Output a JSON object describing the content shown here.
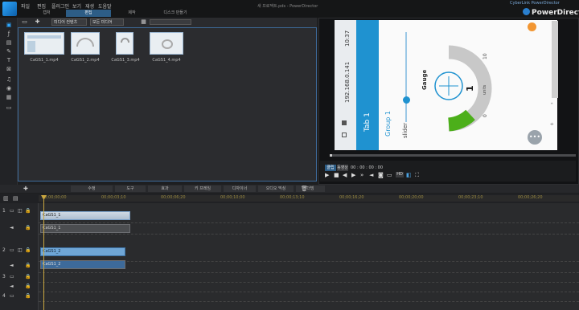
{
  "titlebar": {
    "menus": [
      "파일",
      "편집",
      "플러그인",
      "보기",
      "재생",
      "도움말"
    ],
    "doc_title": "새 프로젝트.pds - PowerDirector",
    "window_title": "CyberLink PowerDirector",
    "brand": "PowerDirector"
  },
  "mode_tabs": [
    "캡처",
    "편집",
    "제작",
    "디스크 만들기"
  ],
  "library": {
    "filter_dropdown": "미디어 컨텐츠",
    "sort_dropdown": "모든 미디어",
    "items": [
      {
        "label": "CaGS1_1.mp4"
      },
      {
        "label": "CaGS1_2.mp4"
      },
      {
        "label": "CaGS1_3.mp4"
      },
      {
        "label": "CaGS1_4.mp4"
      }
    ]
  },
  "preview": {
    "tab_label": "Tab 1",
    "ip_text": "192.168.0.141",
    "time_text": "10:37",
    "group_label": "Group 1",
    "slider_label": "slider",
    "gauge_label": "Gauge",
    "gauge_value": "1",
    "gauge_units": "units",
    "gauge_min": "0",
    "gauge_max": "10",
    "mode_clip": "클립",
    "mode_movie": "동영상",
    "timecode": "00 : 00 : 00 : 00",
    "quality": "HD"
  },
  "funcbar": {
    "buttons": [
      "수정",
      "도구",
      "효과",
      "키 프레임",
      "디자이너",
      "오디오 믹싱",
      "더빙"
    ]
  },
  "timeline": {
    "ruler": [
      "00;00;00;00",
      "00;00;03;10",
      "00;00;06;20",
      "00;00;10;00",
      "00;00;13;10",
      "00;00;16;20",
      "00;00;20;00",
      "00;00;23;10",
      "00;00;26;20"
    ],
    "tracks": [
      {
        "id": "1",
        "video_clip": "CaGS1_1",
        "audio_clip": "CaGS1_1"
      },
      {
        "id": "2",
        "video_clip": "CaGS1_2",
        "audio_clip": "CaGS1_2"
      },
      {
        "id": "3"
      },
      {
        "id": "4"
      }
    ]
  },
  "colors": {
    "accent": "#1f92d0",
    "panel": "#2b2c2f",
    "playhead": "#c9a640"
  }
}
